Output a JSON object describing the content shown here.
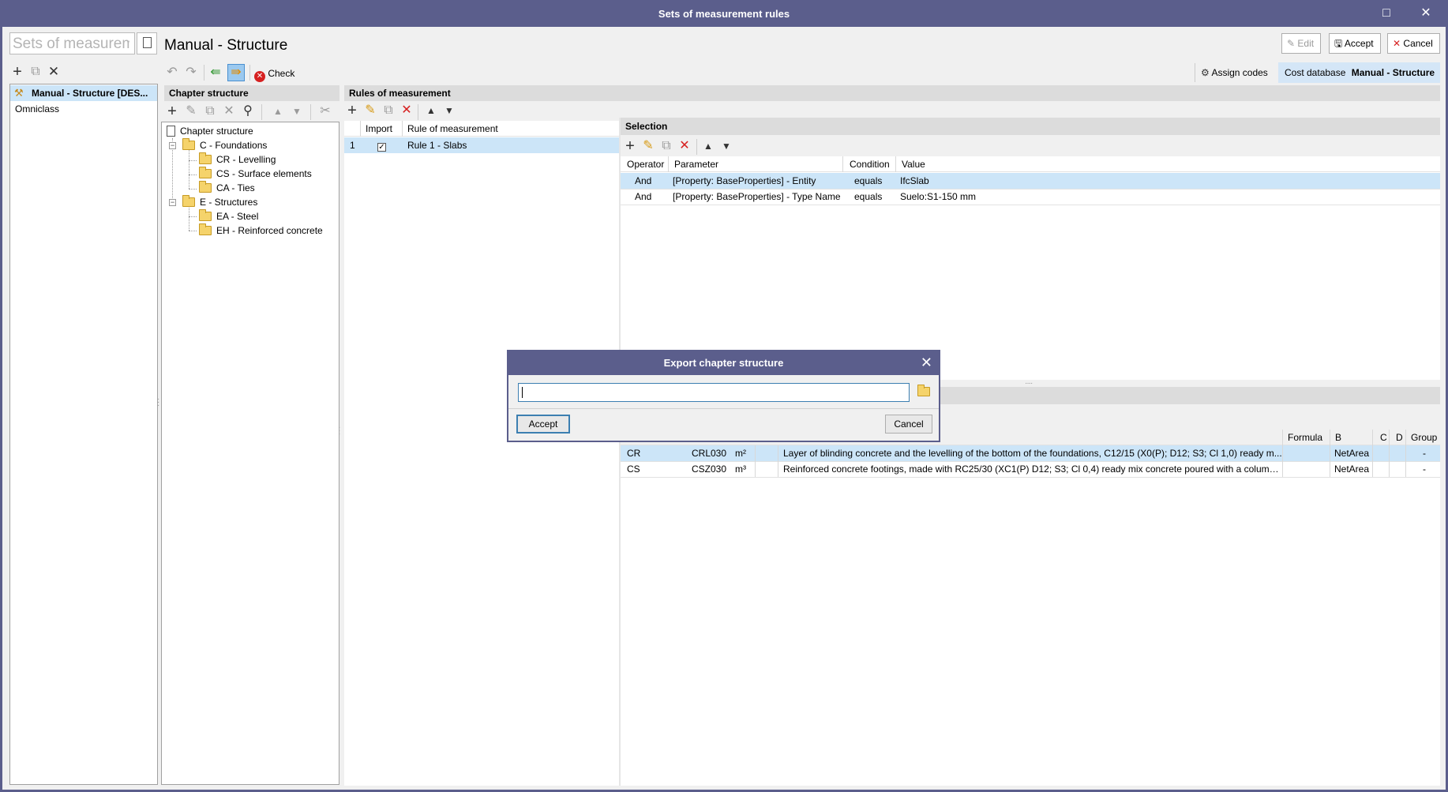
{
  "window": {
    "title": "Sets of measurement rules",
    "maximize_icon": "maximize-icon",
    "close_icon": "close-icon"
  },
  "left_panel": {
    "search_placeholder": "Sets of measurem",
    "items": [
      {
        "label": "Manual - Structure [DES...",
        "selected": true
      },
      {
        "label": "Omniclass",
        "selected": false
      }
    ]
  },
  "header": {
    "title": "Manual - Structure",
    "edit_label": "Edit",
    "accept_label": "Accept",
    "cancel_label": "Cancel"
  },
  "toolbar": {
    "check_label": "Check",
    "assign_codes_label": "Assign codes",
    "cost_database_label": "Cost database",
    "cost_database_value": "Manual - Structure"
  },
  "chapter_structure": {
    "header": "Chapter structure",
    "root": "Chapter structure",
    "tree": [
      {
        "label": "C - Foundations",
        "level": 1,
        "children": [
          {
            "label": "CR - Levelling"
          },
          {
            "label": "CS - Surface elements"
          },
          {
            "label": "CA - Ties"
          }
        ]
      },
      {
        "label": "E - Structures",
        "level": 1,
        "children": [
          {
            "label": "EA - Steel"
          },
          {
            "label": "EH - Reinforced concrete"
          }
        ]
      }
    ]
  },
  "rules": {
    "header": "Rules of measurement",
    "columns": [
      "Import",
      "Rule of measurement"
    ],
    "rows": [
      {
        "index": "1",
        "import": true,
        "name": "Rule 1 - Slabs"
      }
    ]
  },
  "selection": {
    "header": "Selection",
    "columns": [
      "Operator",
      "Parameter",
      "Condition",
      "Value"
    ],
    "rows": [
      {
        "operator": "And",
        "parameter": "[Property: BaseProperties] - Entity",
        "condition": "equals",
        "value": "IfcSlab"
      },
      {
        "operator": "And",
        "parameter": "[Property: BaseProperties] - Type Name",
        "condition": "equals",
        "value": "Suelo:S1-150 mm"
      }
    ]
  },
  "codes": {
    "columns": [
      "Formula",
      "B",
      "C",
      "D",
      "Group"
    ],
    "rows": [
      {
        "chapter": "CR",
        "code": "CRL030",
        "unit": "m²",
        "description": "Layer of blinding concrete and the levelling of the bottom of the foundations,  C12/15 (X0(P); D12; S3; Cl 1,0) ready m...",
        "formula": "",
        "b": "NetArea",
        "c": "",
        "d": "",
        "group": "-"
      },
      {
        "chapter": "CS",
        "code": "CSZ030",
        "unit": "m³",
        "description": "Reinforced concrete footings, made with RC25/30 (XC1(P) D12; S3; Cl 0,4) ready mix concrete poured with a column s...",
        "formula": "",
        "b": "NetArea",
        "c": "",
        "d": "",
        "group": "-"
      }
    ]
  },
  "dialog": {
    "title": "Export chapter structure",
    "input_value": "",
    "accept_label": "Accept",
    "cancel_label": "Cancel"
  }
}
